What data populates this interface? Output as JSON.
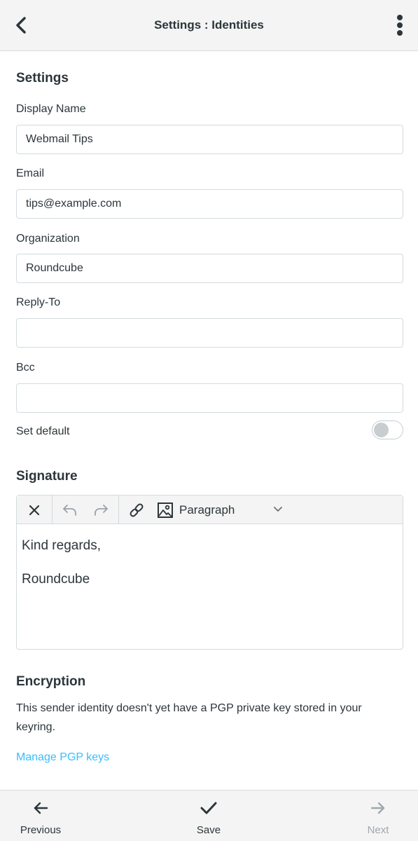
{
  "header": {
    "title": "Settings : Identities",
    "back_icon": "chevron-left-icon",
    "menu_icon": "kebab-menu-icon"
  },
  "settings": {
    "section_title": "Settings",
    "fields": [
      {
        "label": "Display Name",
        "value": "Webmail Tips"
      },
      {
        "label": "Email",
        "value": "tips@example.com"
      },
      {
        "label": "Organization",
        "value": "Roundcube"
      },
      {
        "label": "Reply-To",
        "value": ""
      },
      {
        "label": "Bcc",
        "value": ""
      }
    ],
    "set_default_label": "Set default",
    "set_default_on": false
  },
  "signature": {
    "section_title": "Signature",
    "format_label": "Paragraph",
    "lines": [
      "Kind regards,",
      "Roundcube"
    ]
  },
  "encryption": {
    "section_title": "Encryption",
    "text": "This sender identity doesn't yet have a PGP private key stored in your keyring.",
    "link": "Manage PGP keys"
  },
  "footer": {
    "previous": "Previous",
    "save": "Save",
    "next": "Next",
    "next_disabled": true
  },
  "colors": {
    "accent": "#37beff",
    "text": "#2c363a",
    "border": "#d4dbde",
    "bar_bg": "#f4f4f4"
  }
}
